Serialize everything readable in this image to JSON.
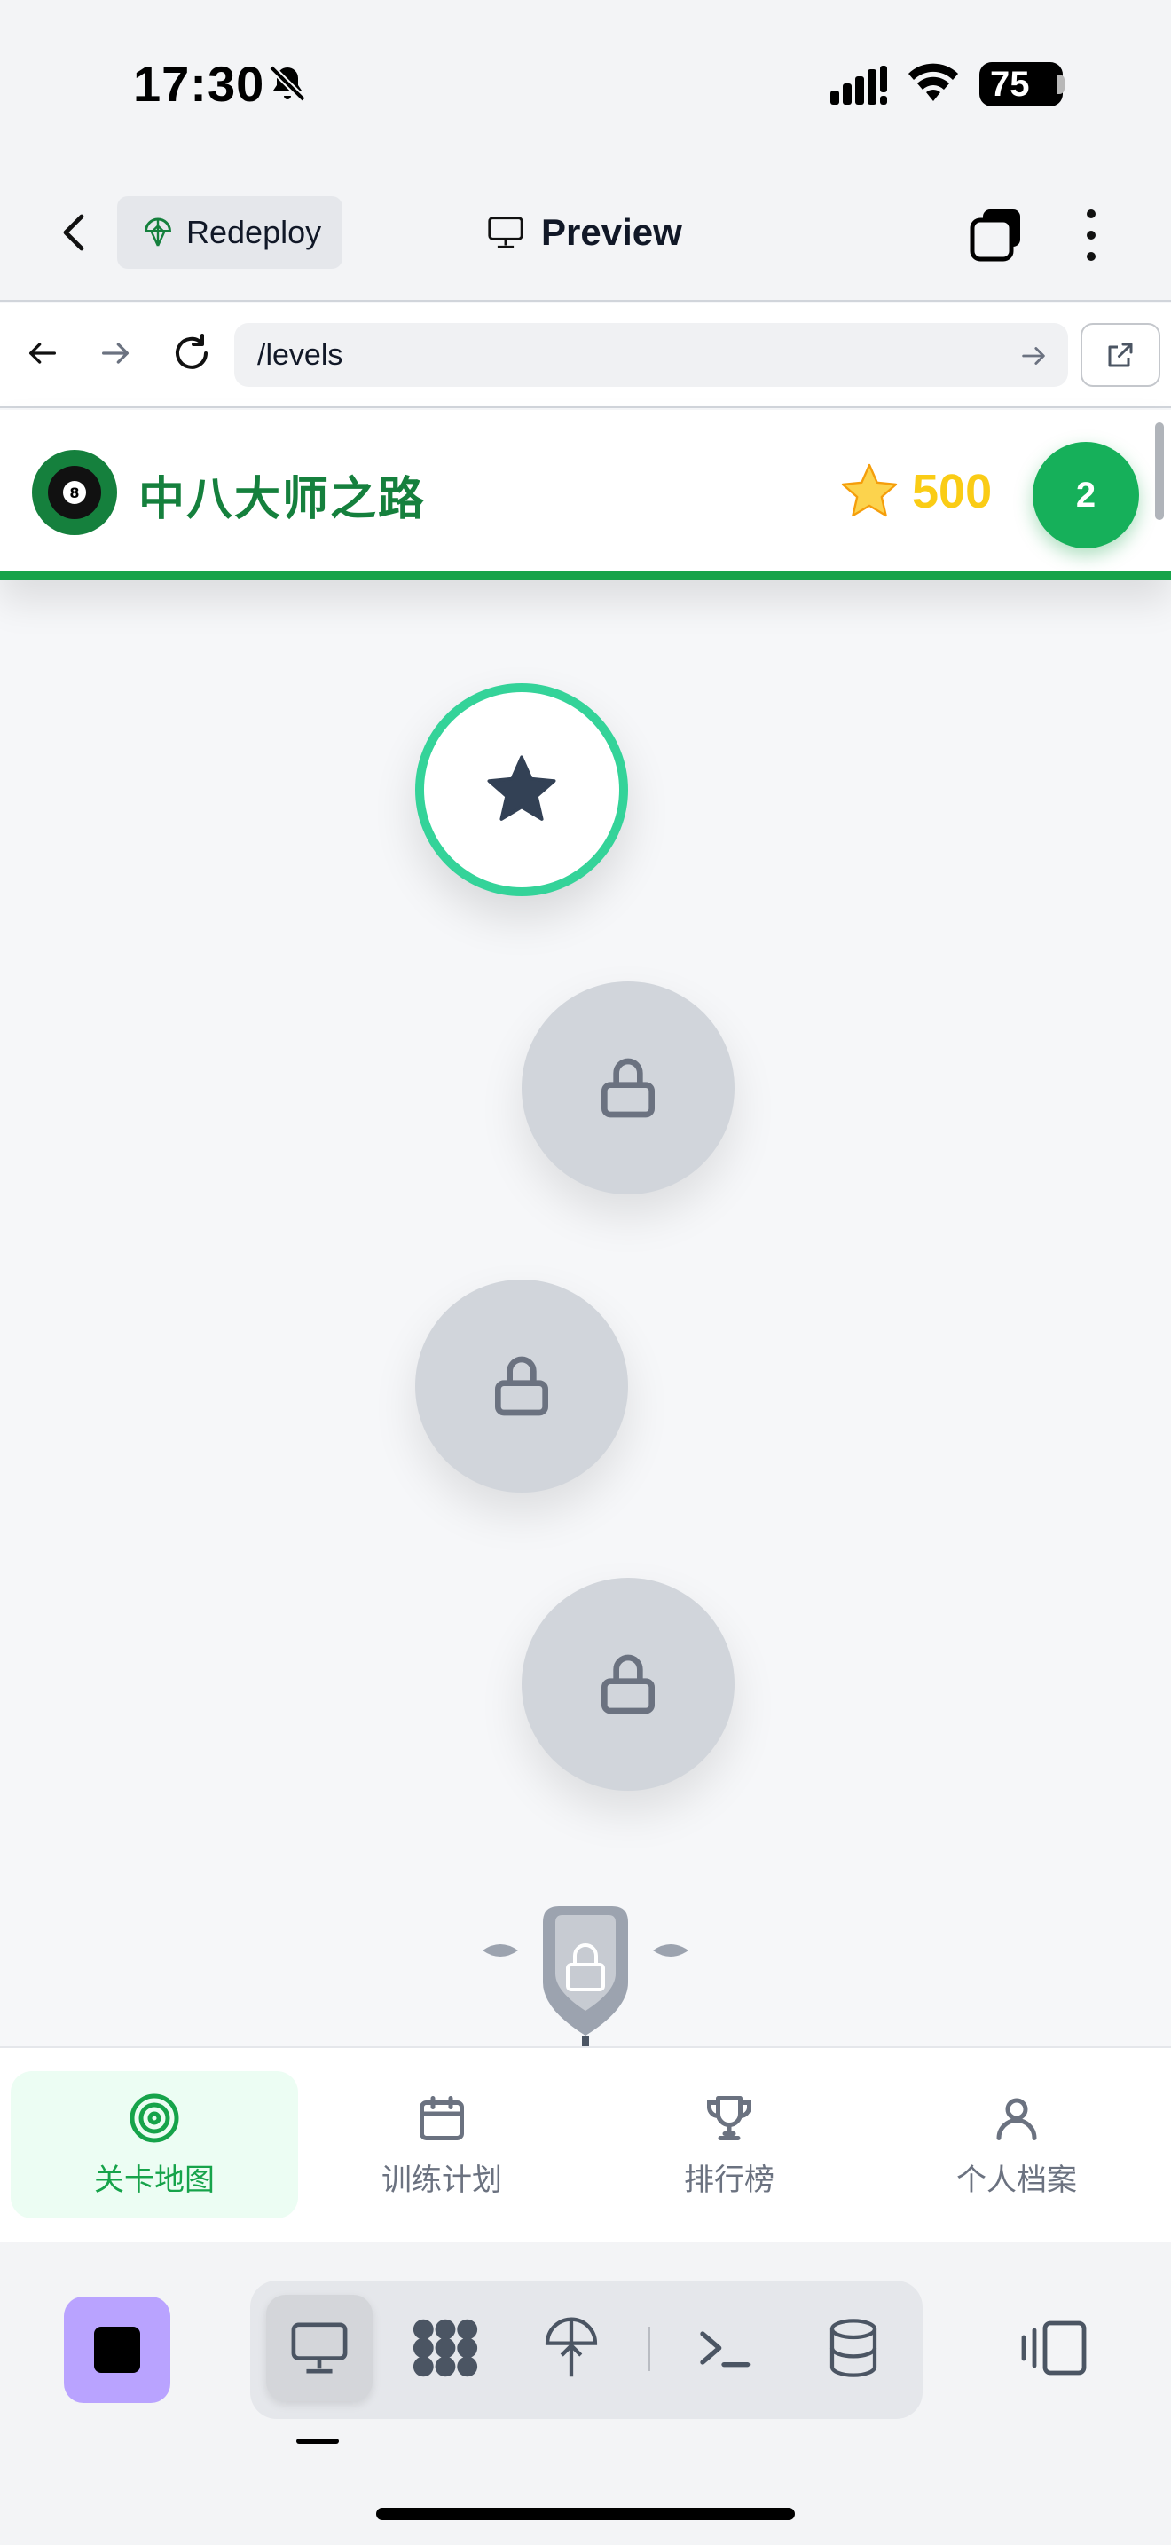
{
  "status": {
    "time": "17:30",
    "battery": "75"
  },
  "app_header": {
    "redeploy_label": "Redeploy",
    "preview_label": "Preview"
  },
  "browser": {
    "url": "/levels"
  },
  "game": {
    "title": "中八大师之路",
    "star_icon": "⭐",
    "stars": "500",
    "level": "2"
  },
  "tabs": [
    {
      "label": "关卡地图",
      "icon": "target-icon",
      "active": true
    },
    {
      "label": "训练计划",
      "icon": "calendar-icon",
      "active": false
    },
    {
      "label": "排行榜",
      "icon": "trophy-icon",
      "active": false
    },
    {
      "label": "个人档案",
      "icon": "user-icon",
      "active": false
    }
  ],
  "colors": {
    "brand_green": "#16a34a",
    "title_green": "#15803d",
    "star_gold": "#facc15",
    "current_ring": "#34d399",
    "locked_node": "#d1d5db",
    "dock_stop": "#b9a3ff"
  }
}
